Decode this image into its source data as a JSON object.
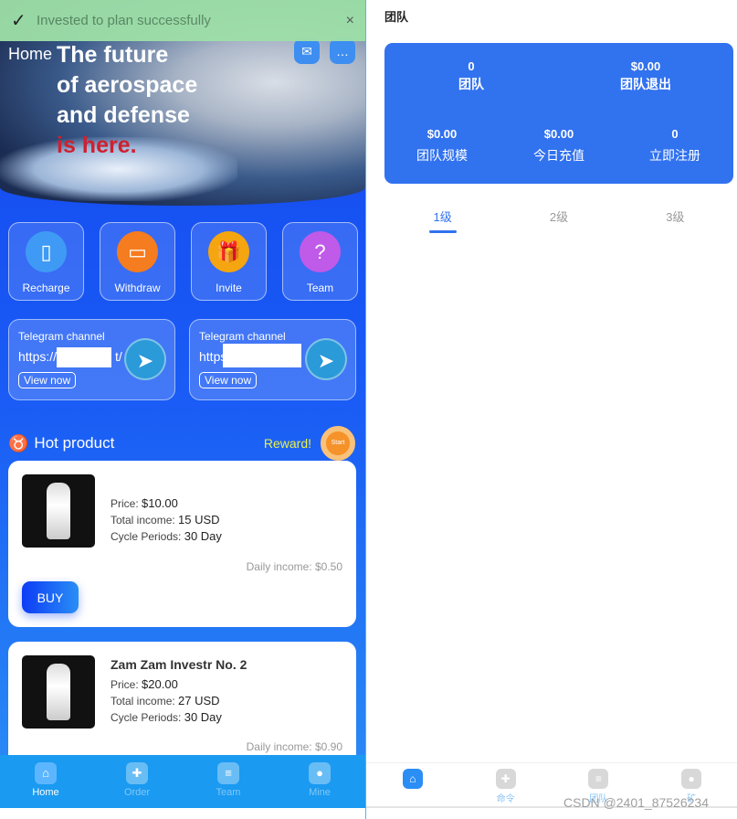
{
  "toast": {
    "message": "Invested to plan successfully",
    "icon": "check-icon",
    "close": "×"
  },
  "banner": {
    "home": "Home",
    "line1": "The future",
    "line2": "of aerospace",
    "line3": "and defense",
    "line4": "is here."
  },
  "actions": [
    {
      "label": "Recharge",
      "icon": "phone-icon",
      "color": "#3f9af5",
      "glyph": "▯"
    },
    {
      "label": "Withdraw",
      "icon": "wallet-icon",
      "color": "#f57c1f",
      "glyph": "▭"
    },
    {
      "label": "Invite",
      "icon": "gift-icon",
      "color": "#f5a50f",
      "glyph": "🎁"
    },
    {
      "label": "Team",
      "icon": "question-chat-icon",
      "color": "#c05ae8",
      "glyph": "?"
    }
  ],
  "telegram": [
    {
      "title": "Telegram channel",
      "url": "https://",
      "url_tail": "t/",
      "button": "View now"
    },
    {
      "title": "Telegram channel",
      "url": "https",
      "url_tail": "",
      "button": "View now"
    }
  ],
  "hot": {
    "title": "Hot product",
    "reward": "Reward!",
    "reward_badge": "Start"
  },
  "products": [
    {
      "name": "",
      "price_label": "Price:",
      "price": "$10.00",
      "income_label": "Total income:",
      "income": "15 USD",
      "cycle_label": "Cycle Periods:",
      "cycle": "30 Day",
      "daily": "Daily income: $0.50",
      "buy": "BUY"
    },
    {
      "name": "Zam Zam Investr No. 2",
      "price_label": "Price:",
      "price": "$20.00",
      "income_label": "Total income:",
      "income": "27 USD",
      "cycle_label": "Cycle Periods:",
      "cycle": "30 Day",
      "daily": "Daily income: $0.90"
    }
  ],
  "nav": [
    {
      "label": "Home",
      "icon": "home-icon"
    },
    {
      "label": "Order",
      "icon": "order-icon"
    },
    {
      "label": "Team",
      "icon": "team-icon"
    },
    {
      "label": "Mine",
      "icon": "user-icon"
    }
  ],
  "team": {
    "title": "团队",
    "stats": [
      {
        "value": "0",
        "label": "团队"
      },
      {
        "value": "$0.00",
        "label": "团队退出"
      },
      {
        "value": "$0.00",
        "label": "团队规模"
      },
      {
        "value": "$0.00",
        "label": "今日充值"
      },
      {
        "value": "0",
        "label": "立即注册"
      }
    ],
    "tabs": [
      "1级",
      "2级",
      "3级"
    ],
    "nav": [
      {
        "label": "",
        "icon": "home-icon"
      },
      {
        "label": "命令",
        "icon": "order-icon"
      },
      {
        "label": "团队",
        "icon": "team-icon"
      },
      {
        "label": "矿",
        "icon": "user-icon"
      }
    ]
  },
  "watermark": "CSDN @2401_87526234"
}
